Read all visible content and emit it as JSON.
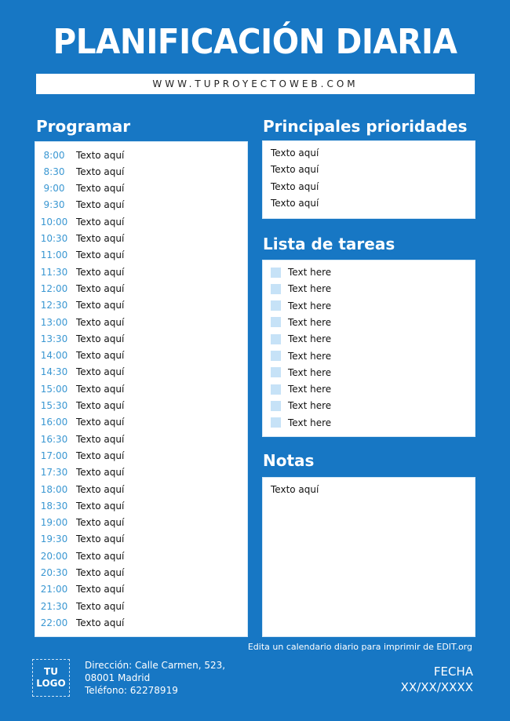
{
  "header": {
    "title": "PLANIFICACIÓN DIARIA",
    "website": "WWW.TUPROYECTOWEB.COM"
  },
  "schedule": {
    "title": "Programar",
    "rows": [
      {
        "time": "8:00",
        "text": "Texto aquí"
      },
      {
        "time": "8:30",
        "text": "Texto aquí"
      },
      {
        "time": "9:00",
        "text": "Texto aquí"
      },
      {
        "time": "9:30",
        "text": "Texto aquí"
      },
      {
        "time": "10:00",
        "text": "Texto aquí"
      },
      {
        "time": "10:30",
        "text": "Texto aquí"
      },
      {
        "time": "11:00",
        "text": "Texto aquí"
      },
      {
        "time": "11:30",
        "text": "Texto aquí"
      },
      {
        "time": "12:00",
        "text": "Texto aquí"
      },
      {
        "time": "12:30",
        "text": "Texto aquí"
      },
      {
        "time": "13:00",
        "text": "Texto aquí"
      },
      {
        "time": "13:30",
        "text": "Texto aquí"
      },
      {
        "time": "14:00",
        "text": "Texto aquí"
      },
      {
        "time": "14:30",
        "text": "Texto aquí"
      },
      {
        "time": "15:00",
        "text": "Texto aquí"
      },
      {
        "time": "15:30",
        "text": "Texto aquí"
      },
      {
        "time": "16:00",
        "text": "Texto aquí"
      },
      {
        "time": "16:30",
        "text": "Texto aquí"
      },
      {
        "time": "17:00",
        "text": "Texto aquí"
      },
      {
        "time": "17:30",
        "text": "Texto aquí"
      },
      {
        "time": "18:00",
        "text": "Texto aquí"
      },
      {
        "time": "18:30",
        "text": "Texto aquí"
      },
      {
        "time": "19:00",
        "text": "Texto aquí"
      },
      {
        "time": "19:30",
        "text": "Texto aquí"
      },
      {
        "time": "20:00",
        "text": "Texto aquí"
      },
      {
        "time": "20:30",
        "text": "Texto aquí"
      },
      {
        "time": "21:00",
        "text": "Texto aquí"
      },
      {
        "time": "21:30",
        "text": "Texto aquí"
      },
      {
        "time": "22:00",
        "text": "Texto aquí"
      }
    ]
  },
  "priorities": {
    "title": "Principales prioridades",
    "items": [
      "Texto aquí",
      "Texto aquí",
      "Texto aquí",
      "Texto aquí"
    ]
  },
  "tasks": {
    "title": "Lista de tareas",
    "items": [
      {
        "label": "Text here",
        "checked": false
      },
      {
        "label": "Text here",
        "checked": false
      },
      {
        "label": "Text here",
        "checked": false
      },
      {
        "label": "Text here",
        "checked": false
      },
      {
        "label": "Text here",
        "checked": false
      },
      {
        "label": "Text here",
        "checked": false
      },
      {
        "label": "Text here",
        "checked": false
      },
      {
        "label": "Text here",
        "checked": false
      },
      {
        "label": "Text here",
        "checked": false
      },
      {
        "label": "Text here",
        "checked": false
      }
    ]
  },
  "notes": {
    "title": "Notas",
    "text": "Texto aquí"
  },
  "footer": {
    "credit": "Edita un calendario diario para imprimir de EDIT.org",
    "logo_line1": "TU",
    "logo_line2": "LOGO",
    "address_line1": "Dirección: Calle Carmen, 523,",
    "address_line2": "08001 Madrid",
    "phone": "Teléfono: 62278919",
    "date_label": "FECHA",
    "date_value": "XX/XX/XXXX"
  },
  "colors": {
    "background": "#1777c4",
    "time_text": "#3a97d2",
    "checkbox": "#c6e2f7"
  }
}
